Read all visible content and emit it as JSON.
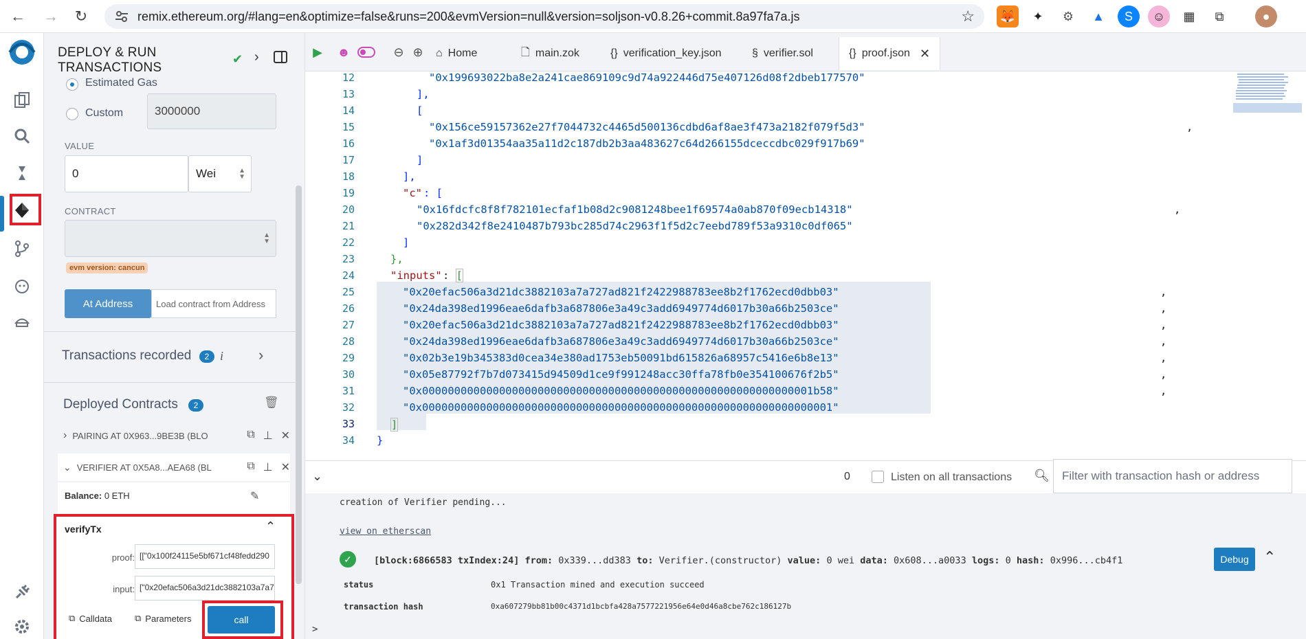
{
  "browser": {
    "url": "remix.ethereum.org/#lang=en&optimize=false&runs=200&evmVersion=null&version=soljson-v0.8.26+commit.8a97fa7a.js"
  },
  "panel": {
    "title_line1": "DEPLOY & RUN",
    "title_line2": "TRANSACTIONS",
    "estimated_gas_label": "Estimated Gas",
    "custom_label": "Custom",
    "custom_gas_value": "3000000",
    "value_label": "VALUE",
    "value_amount": "0",
    "value_unit": "Wei",
    "contract_label": "CONTRACT",
    "evm_badge": "evm version: cancun",
    "at_address_button": "At Address",
    "load_contract_placeholder": "Load contract from Address",
    "transactions_recorded_label": "Transactions recorded",
    "transactions_recorded_count": "2",
    "info_glyph": "i",
    "deployed_contracts_label": "Deployed Contracts",
    "deployed_contracts_count": "2",
    "contracts": [
      {
        "label": "PAIRING AT 0X963...9BE3B (BLO"
      },
      {
        "label": "VERIFIER AT 0X5A8...AEA68 (BL"
      }
    ],
    "balance_label": "Balance:",
    "balance_value": "0 ETH",
    "function_name": "verifyTx",
    "proof_label": "proof:",
    "proof_value": "[[\"0x100f24115e5bf671cf48fedd290",
    "input_label": "input:",
    "input_value": "[\"0x20efac506a3d21dc3882103a7a7",
    "calldata_button": "Calldata",
    "parameters_button": "Parameters",
    "call_button": "call"
  },
  "tabs": {
    "home": "Home",
    "files": [
      "main.zok",
      "verification_key.json",
      "verifier.sol",
      "proof.json"
    ]
  },
  "editor": {
    "line_numbers": [
      "12",
      "13",
      "14",
      "15",
      "16",
      "17",
      "18",
      "19",
      "20",
      "21",
      "22",
      "23",
      "24",
      "25",
      "26",
      "27",
      "28",
      "29",
      "30",
      "31",
      "32",
      "33",
      "34"
    ],
    "lines": {
      "l12": "\"0x199693022ba8e2a241cae869109c9d74a922446d75e407126d08f2dbeb177570\"",
      "l15": "\"0x156ce59157362e27f7044732c4465d500136cdbd6af8ae3f473a2182f079f5d3\"",
      "l16": "\"0x1af3d01354aa35a11d2c187db2b3aa483627c64d266155dceccdbc029f917b69\"",
      "l19_key": "\"c\"",
      "l20": "\"0x16fdcfc8f8f782101ecfaf1b08d2c9081248bee1f69574a0ab870f09ecb14318\"",
      "l21": "\"0x282d342f8e2410487b793bc285d74c2963f1f5d2c7eebd789f53a9310c0df065\"",
      "l24_key": "\"inputs\"",
      "l25": "\"0x20efac506a3d21dc3882103a7a727ad821f2422988783ee8b2f1762ecd0dbb03\"",
      "l26": "\"0x24da398ed1996eae6dafb3a687806e3a49c3add6949774d6017b30a66b2503ce\"",
      "l27": "\"0x20efac506a3d21dc3882103a7a727ad821f2422988783ee8b2f1762ecd0dbb03\"",
      "l28": "\"0x24da398ed1996eae6dafb3a687806e3a49c3add6949774d6017b30a66b2503ce\"",
      "l29": "\"0x02b3e19b345383d0cea34e380ad1753eb50091bd615826a68957c5416e6b8e13\"",
      "l30": "\"0x05e87792f7b7d073415d94509d1ce9f991248acc30ffa78fb0e354100676f2b5\"",
      "l31": "\"0x0000000000000000000000000000000000000000000000000000000000001b58\"",
      "l32": "\"0x0000000000000000000000000000000000000000000000000000000000000001\""
    }
  },
  "terminal": {
    "pending_count": "0",
    "listen_label": "Listen on all transactions",
    "filter_placeholder": "Filter with transaction hash or address",
    "pending_text": "creation of Verifier pending...",
    "etherscan_link": "view on etherscan",
    "tx_block": "[block:6866583 txIndex:24]",
    "tx_from_label": "from:",
    "tx_from": "0x339...dd383",
    "tx_to_label": "to:",
    "tx_to": "Verifier.(constructor)",
    "tx_value_label": "value:",
    "tx_value": "0 wei",
    "tx_data_label": "data:",
    "tx_data": "0x608...a0033",
    "tx_logs_label": "logs:",
    "tx_logs": "0",
    "tx_hash_label": "hash:",
    "tx_hash": "0x996...cb4f1",
    "debug_button": "Debug",
    "status_key": "status",
    "status_value": "0x1 Transaction mined and execution succeed",
    "txhash_key": "transaction hash",
    "txhash_value": "0xa607279bb81b00c4371d1bcbfa428a7577221956e64e0d46a8cbe762c186127b",
    "prompt": ">"
  }
}
